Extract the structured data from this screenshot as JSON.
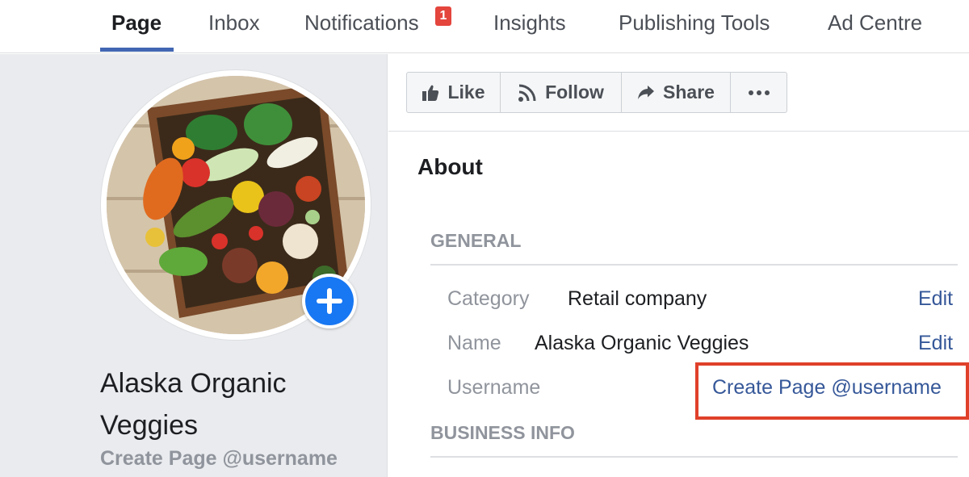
{
  "tabs": [
    {
      "label": "Page",
      "active": true
    },
    {
      "label": "Inbox"
    },
    {
      "label": "Notifications",
      "badge": "1"
    },
    {
      "label": "Insights"
    },
    {
      "label": "Publishing Tools"
    },
    {
      "label": "Ad Centre"
    }
  ],
  "profile": {
    "name": "Alaska Organic Veggies",
    "username_link": "Create Page @username",
    "avatar_icon": "vegetable-crate-photo",
    "add_icon": "plus-icon"
  },
  "actions": [
    {
      "label": "Like",
      "icon": "thumbs-up-icon"
    },
    {
      "label": "Follow",
      "icon": "rss-icon"
    },
    {
      "label": "Share",
      "icon": "share-arrow-icon"
    },
    {
      "label": "",
      "icon": "more-dots-icon"
    }
  ],
  "about": {
    "title": "About",
    "general_label": "GENERAL",
    "business_label": "BUSINESS INFO",
    "rows": [
      {
        "label": "Category",
        "value": "Retail company",
        "action": "Edit"
      },
      {
        "label": "Name",
        "value": "Alaska Organic Veggies",
        "action": "Edit"
      },
      {
        "label": "Username",
        "value": "Create Page @username"
      }
    ]
  },
  "colors": {
    "accent": "#4267b2",
    "link": "#365899",
    "badge": "#e4453d",
    "highlight": "#e0402a",
    "add_button": "#1877f2"
  }
}
